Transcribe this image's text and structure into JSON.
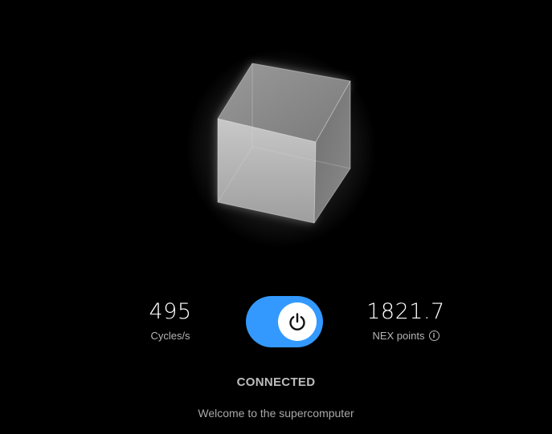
{
  "stats": {
    "cycles": {
      "value": "495",
      "label": "Cycles/s"
    },
    "points": {
      "value": "1821.7",
      "label": "NEX points",
      "info_icon": "info-icon"
    }
  },
  "power_toggle": {
    "state": "on",
    "icon": "power-icon",
    "color": "#3399ff"
  },
  "status": {
    "text": "CONNECTED"
  },
  "welcome": {
    "text": "Welcome to the supercomputer"
  }
}
